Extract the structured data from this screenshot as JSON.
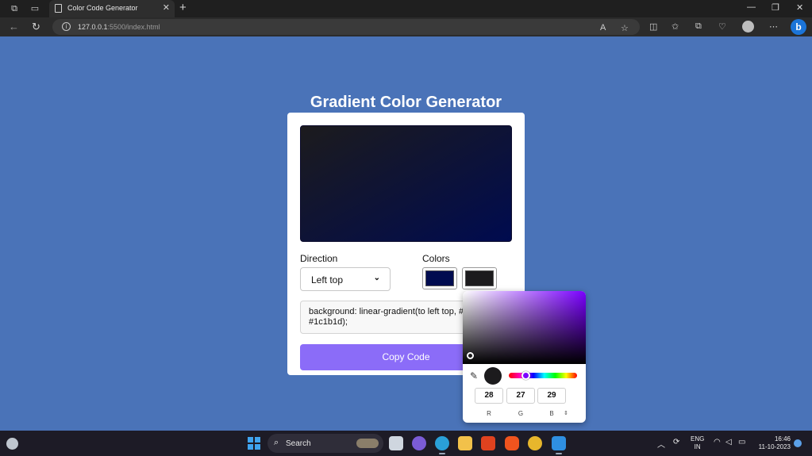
{
  "browser": {
    "tab_title": "Color Code Generator",
    "url_host": "127.0.0.1",
    "url_path": ":5500/index.html"
  },
  "page": {
    "title": "Gradient Color Generator",
    "direction_label": "Direction",
    "direction_value": "Left top",
    "colors_label": "Colors",
    "color1": "#000b4f",
    "color2": "#1c1b1d",
    "code_text": "background: linear-gradient(to left top, #000b4f, #1c1b1d);",
    "copy_button": "Copy Code"
  },
  "picker": {
    "r": "28",
    "g": "27",
    "b": "29",
    "r_label": "R",
    "g_label": "G",
    "b_label": "B"
  },
  "taskbar": {
    "search_placeholder": "Search",
    "lang_line1": "ENG",
    "lang_line2": "IN",
    "time": "16:46",
    "date": "11-10-2023"
  },
  "colors": {
    "page_bg": "#4a73b8",
    "button": "#8b6cf8",
    "hue_selected": "#7a00ff"
  }
}
